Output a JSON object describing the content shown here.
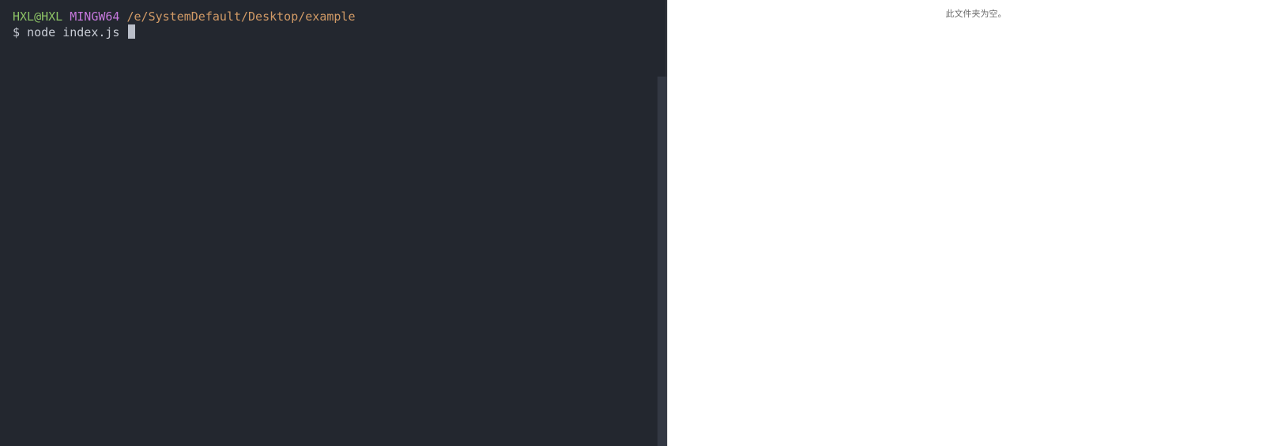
{
  "terminal": {
    "prompt": {
      "user_host": "HXL@HXL",
      "environment": "MINGW64",
      "path": "/e/SystemDefault/Desktop/example"
    },
    "command_line": {
      "symbol": "$",
      "command": "node index.js"
    }
  },
  "explorer": {
    "empty_message": "此文件夹为空。"
  },
  "colors": {
    "terminal_background": "#23272f",
    "user_host": "#8cc265",
    "environment": "#c678dd",
    "path": "#d19a66",
    "text": "#c7cbd4",
    "explorer_background": "#ffffff"
  }
}
